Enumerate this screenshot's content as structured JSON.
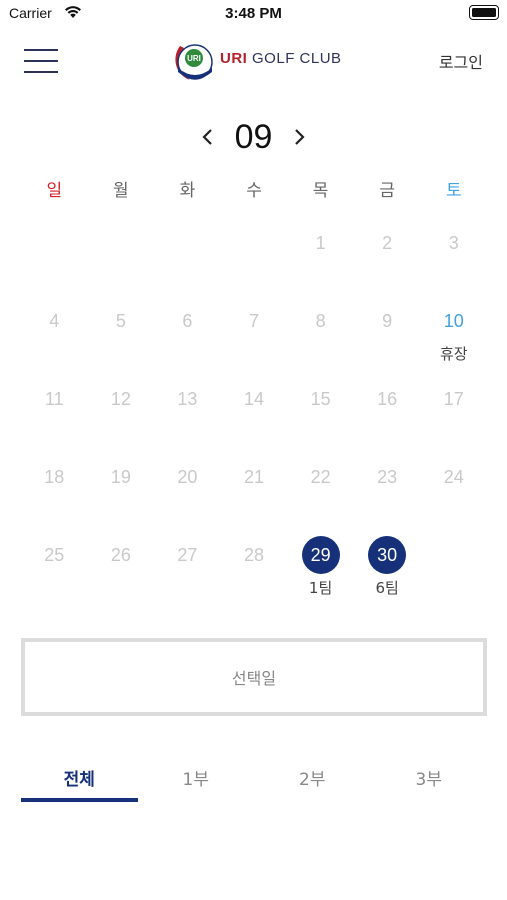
{
  "status_bar": {
    "carrier": "Carrier",
    "time": "3:48 PM"
  },
  "header": {
    "logo_brand": "URI",
    "logo_name": "GOLF CLUB",
    "login_label": "로그인"
  },
  "calendar": {
    "month": "09",
    "weekdays": [
      "일",
      "월",
      "화",
      "수",
      "목",
      "금",
      "토"
    ],
    "weeks": [
      [
        {
          "day": ""
        },
        {
          "day": ""
        },
        {
          "day": ""
        },
        {
          "day": ""
        },
        {
          "day": "1"
        },
        {
          "day": "2"
        },
        {
          "day": "3"
        }
      ],
      [
        {
          "day": "4"
        },
        {
          "day": "5"
        },
        {
          "day": "6"
        },
        {
          "day": "7"
        },
        {
          "day": "8"
        },
        {
          "day": "9"
        },
        {
          "day": "10",
          "note": "휴장",
          "holiday": true
        }
      ],
      [
        {
          "day": "11"
        },
        {
          "day": "12"
        },
        {
          "day": "13"
        },
        {
          "day": "14"
        },
        {
          "day": "15"
        },
        {
          "day": "16"
        },
        {
          "day": "17"
        }
      ],
      [
        {
          "day": "18"
        },
        {
          "day": "19"
        },
        {
          "day": "20"
        },
        {
          "day": "21"
        },
        {
          "day": "22"
        },
        {
          "day": "23"
        },
        {
          "day": "24"
        }
      ],
      [
        {
          "day": "25"
        },
        {
          "day": "26"
        },
        {
          "day": "27"
        },
        {
          "day": "28"
        },
        {
          "day": "29",
          "note": "1팀",
          "available": true
        },
        {
          "day": "30",
          "note": "6팀",
          "available": true
        },
        {
          "day": ""
        }
      ]
    ]
  },
  "selected_date": {
    "placeholder": "선택일"
  },
  "tabs": [
    {
      "label": "전체",
      "active": true
    },
    {
      "label": "1부",
      "active": false
    },
    {
      "label": "2부",
      "active": false
    },
    {
      "label": "3부",
      "active": false
    }
  ],
  "colors": {
    "primary": "#16317a",
    "sunday": "#d6222c",
    "saturday": "#3fa2e0",
    "inactive_day": "#c9c9c9"
  }
}
